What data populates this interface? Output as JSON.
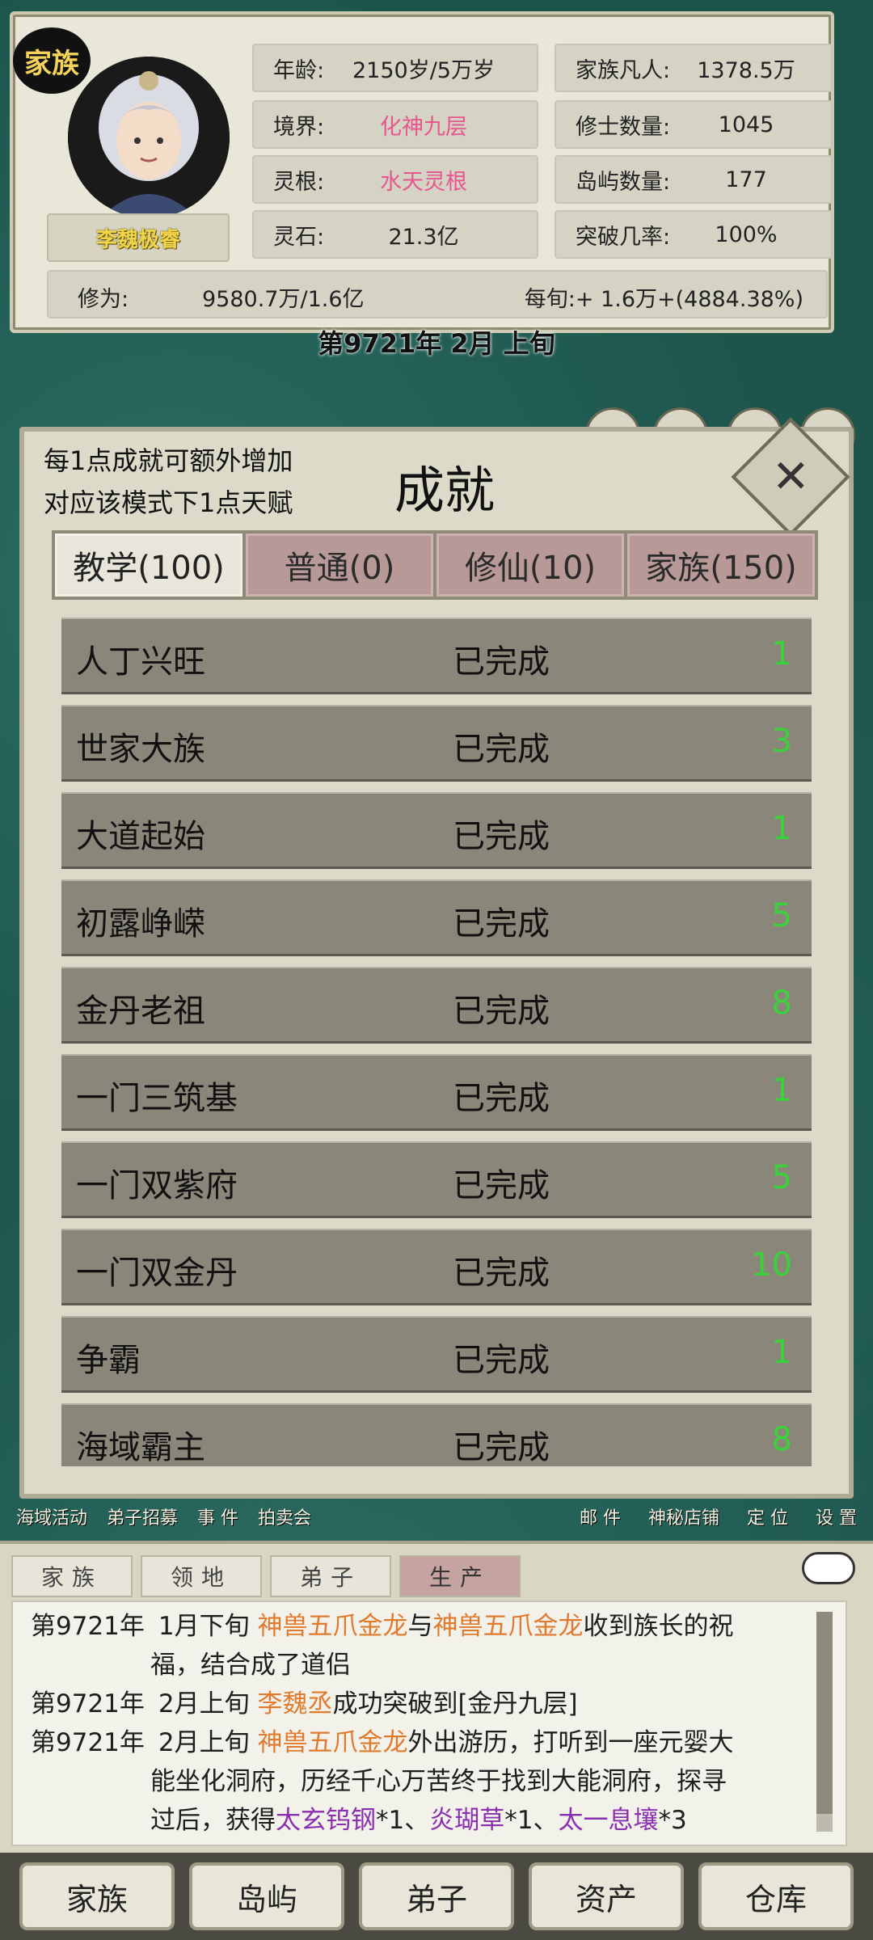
{
  "stats": {
    "clan_badge": "家族",
    "player_name": "李魏极睿",
    "age_label": "年龄:",
    "age_value": "2150岁/5万岁",
    "realm_label": "境界:",
    "realm_value": "化神九层",
    "root_label": "灵根:",
    "root_value": "水天灵根",
    "stone_label": "灵石:",
    "stone_value": "21.3亿",
    "mortals_label": "家族凡人:",
    "mortals_value": "1378.5万",
    "cultivators_label": "修士数量:",
    "cultivators_value": "1045",
    "islands_label": "岛屿数量:",
    "islands_value": "177",
    "breakthrough_label": "突破几率:",
    "breakthrough_value": "100%",
    "cultivation_label": "修为:",
    "cultivation_value": "9580.7万/1.6亿",
    "per_xun": "每旬:+ 1.6万+(4884.38%)",
    "cultivation_progress": 0.599
  },
  "date": "第9721年 2月 上旬",
  "modal": {
    "note_line1": "每1点成就可额外增加",
    "note_line2": "对应该模式下1点天赋",
    "title": "成就",
    "close_symbol": "✕",
    "tabs": [
      {
        "label": "教学(100)",
        "active": true
      },
      {
        "label": "普通(0)",
        "active": false
      },
      {
        "label": "修仙(10)",
        "active": false
      },
      {
        "label": "家族(150)",
        "active": false
      }
    ],
    "achievements": [
      {
        "name": "人丁兴旺",
        "status": "已完成",
        "points": "1"
      },
      {
        "name": "世家大族",
        "status": "已完成",
        "points": "3"
      },
      {
        "name": "大道起始",
        "status": "已完成",
        "points": "1"
      },
      {
        "name": "初露峥嵘",
        "status": "已完成",
        "points": "5"
      },
      {
        "name": "金丹老祖",
        "status": "已完成",
        "points": "8"
      },
      {
        "name": "一门三筑基",
        "status": "已完成",
        "points": "1"
      },
      {
        "name": "一门双紫府",
        "status": "已完成",
        "points": "5"
      },
      {
        "name": "一门双金丹",
        "status": "已完成",
        "points": "10"
      },
      {
        "name": "争霸",
        "status": "已完成",
        "points": "1"
      },
      {
        "name": "海域霸主",
        "status": "已完成",
        "points": "8"
      }
    ]
  },
  "actions": {
    "left": [
      "海域活动",
      "弟子招募",
      "事 件",
      "拍卖会"
    ],
    "right": [
      "邮 件",
      "神秘店铺",
      "定 位",
      "设 置"
    ]
  },
  "log": {
    "tabs": [
      "家族",
      "领地",
      "弟子",
      "生产"
    ],
    "active_tab": 3,
    "entries": [
      {
        "year": "第9721年",
        "time": "1月下旬",
        "who": "神兽五爪金龙",
        "mid": "与",
        "who2": "神兽五爪金龙",
        "text": "收到族长的祝",
        "cont": "福，结合成了道侣"
      },
      {
        "year": "第9721年",
        "time": "2月上旬",
        "who": "李魏丞",
        "text": "成功突破到[金丹九层]"
      },
      {
        "year": "第9721年",
        "time": "2月上旬",
        "who": "神兽五爪金龙",
        "text": "外出游历，打听到一座元婴大",
        "cont": "能坐化洞府，历经千心万苦终于找到大能洞府，探寻",
        "cont2_prefix": "过后，获得",
        "item1": "太玄钨钢",
        "sep1": "*1、",
        "item2": "炎瑚草",
        "sep2": "*1、",
        "item3": "太一息壤",
        "sep3": "*3"
      }
    ]
  },
  "nav": [
    "家族",
    "岛屿",
    "弟子",
    "资产",
    "仓库"
  ]
}
